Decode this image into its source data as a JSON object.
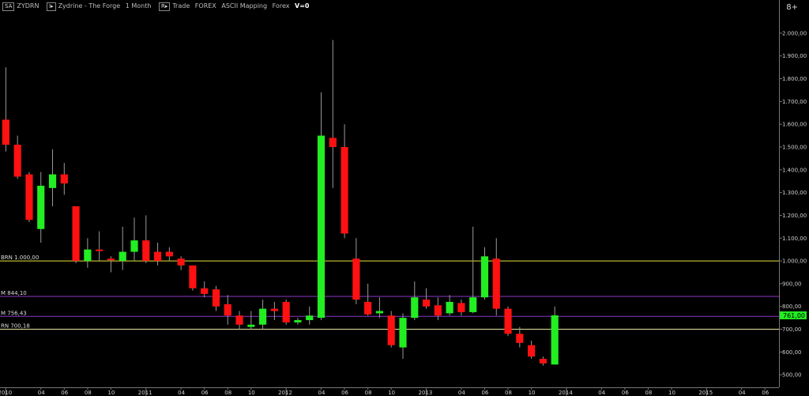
{
  "toolbar": {
    "symbol_box": "SA",
    "symbol": "ZYDRN",
    "interval_box": "I▸",
    "description": "Zydrine - The Forge",
    "period": "1 Month",
    "r_box": "R▸",
    "trade_label": "Trade",
    "market_label": "FOREX",
    "mapping_label": "ASCII Mapping",
    "forex_label": "Forex",
    "volume_label": "V=0",
    "corner_glyph": "8+"
  },
  "chart_data": {
    "type": "candlestick",
    "ylim": [
      445,
      2090
    ],
    "y_ticks": [
      500,
      600,
      700,
      800,
      900,
      1000,
      1100,
      1200,
      1300,
      1400,
      1500,
      1600,
      1700,
      1800,
      1900,
      2000
    ],
    "y_tick_labels": [
      "500,00",
      "600,00",
      "700,00",
      "800,00",
      "900,00",
      "1.000,00",
      "1.100,00",
      "1.200,00",
      "1.300,00",
      "1.400,00",
      "1.500,00",
      "1.600,00",
      "1.700,00",
      "1.800,00",
      "1.900,00",
      "2.000,00"
    ],
    "x_ticks": [
      {
        "month": 0,
        "label": "2010"
      },
      {
        "month": 3,
        "label": "04"
      },
      {
        "month": 5,
        "label": "06"
      },
      {
        "month": 7,
        "label": "08"
      },
      {
        "month": 9,
        "label": "10"
      },
      {
        "month": 12,
        "label": "2011"
      },
      {
        "month": 15,
        "label": "04"
      },
      {
        "month": 17,
        "label": "06"
      },
      {
        "month": 19,
        "label": "08"
      },
      {
        "month": 21,
        "label": "10"
      },
      {
        "month": 24,
        "label": "2012"
      },
      {
        "month": 27,
        "label": "04"
      },
      {
        "month": 29,
        "label": "06"
      },
      {
        "month": 31,
        "label": "08"
      },
      {
        "month": 33,
        "label": "10"
      },
      {
        "month": 36,
        "label": "2013"
      },
      {
        "month": 39,
        "label": "04"
      },
      {
        "month": 41,
        "label": "06"
      },
      {
        "month": 43,
        "label": "08"
      },
      {
        "month": 45,
        "label": "10"
      },
      {
        "month": 48,
        "label": "2014"
      },
      {
        "month": 51,
        "label": "04"
      },
      {
        "month": 53,
        "label": "06"
      },
      {
        "month": 55,
        "label": "08"
      },
      {
        "month": 57,
        "label": "10"
      },
      {
        "month": 60,
        "label": "2015"
      },
      {
        "month": 63,
        "label": "04"
      },
      {
        "month": 65,
        "label": "06"
      }
    ],
    "x_range_months": [
      -0.5,
      66.2
    ],
    "candles": [
      {
        "m": 0,
        "o": 1620,
        "h": 1850,
        "l": 1480,
        "c": 1510
      },
      {
        "m": 1,
        "o": 1510,
        "h": 1550,
        "l": 1360,
        "c": 1370
      },
      {
        "m": 2,
        "o": 1380,
        "h": 1390,
        "l": 1170,
        "c": 1180
      },
      {
        "m": 3,
        "o": 1140,
        "h": 1390,
        "l": 1080,
        "c": 1330
      },
      {
        "m": 4,
        "o": 1320,
        "h": 1490,
        "l": 1240,
        "c": 1380
      },
      {
        "m": 5,
        "o": 1380,
        "h": 1430,
        "l": 1290,
        "c": 1340
      },
      {
        "m": 6,
        "o": 1240,
        "h": 1240,
        "l": 990,
        "c": 1000
      },
      {
        "m": 7,
        "o": 1000,
        "h": 1100,
        "l": 970,
        "c": 1050
      },
      {
        "m": 8,
        "o": 1050,
        "h": 1130,
        "l": 1000,
        "c": 1045
      },
      {
        "m": 9,
        "o": 1010,
        "h": 1020,
        "l": 950,
        "c": 1005
      },
      {
        "m": 10,
        "o": 1000,
        "h": 1150,
        "l": 960,
        "c": 1040
      },
      {
        "m": 11,
        "o": 1040,
        "h": 1190,
        "l": 1000,
        "c": 1090
      },
      {
        "m": 12,
        "o": 1090,
        "h": 1200,
        "l": 990,
        "c": 1000
      },
      {
        "m": 13,
        "o": 1040,
        "h": 1080,
        "l": 980,
        "c": 1000
      },
      {
        "m": 14,
        "o": 1040,
        "h": 1060,
        "l": 1000,
        "c": 1020
      },
      {
        "m": 15,
        "o": 1010,
        "h": 1020,
        "l": 960,
        "c": 980
      },
      {
        "m": 16,
        "o": 980,
        "h": 980,
        "l": 870,
        "c": 880
      },
      {
        "m": 17,
        "o": 880,
        "h": 910,
        "l": 840,
        "c": 855
      },
      {
        "m": 18,
        "o": 875,
        "h": 890,
        "l": 780,
        "c": 800
      },
      {
        "m": 19,
        "o": 810,
        "h": 850,
        "l": 720,
        "c": 760
      },
      {
        "m": 20,
        "o": 760,
        "h": 780,
        "l": 700,
        "c": 720
      },
      {
        "m": 21,
        "o": 710,
        "h": 780,
        "l": 700,
        "c": 720
      },
      {
        "m": 22,
        "o": 720,
        "h": 830,
        "l": 700,
        "c": 790
      },
      {
        "m": 23,
        "o": 790,
        "h": 820,
        "l": 740,
        "c": 780
      },
      {
        "m": 24,
        "o": 820,
        "h": 830,
        "l": 720,
        "c": 730
      },
      {
        "m": 25,
        "o": 730,
        "h": 750,
        "l": 720,
        "c": 740
      },
      {
        "m": 26,
        "o": 740,
        "h": 800,
        "l": 720,
        "c": 760
      },
      {
        "m": 27,
        "o": 750,
        "h": 1740,
        "l": 740,
        "c": 1550
      },
      {
        "m": 28,
        "o": 1540,
        "h": 1970,
        "l": 1320,
        "c": 1500
      },
      {
        "m": 29,
        "o": 1500,
        "h": 1600,
        "l": 1100,
        "c": 1120
      },
      {
        "m": 30,
        "o": 1010,
        "h": 1100,
        "l": 810,
        "c": 830
      },
      {
        "m": 31,
        "o": 820,
        "h": 900,
        "l": 760,
        "c": 765
      },
      {
        "m": 32,
        "o": 770,
        "h": 840,
        "l": 750,
        "c": 780
      },
      {
        "m": 33,
        "o": 760,
        "h": 780,
        "l": 620,
        "c": 630
      },
      {
        "m": 34,
        "o": 620,
        "h": 770,
        "l": 570,
        "c": 750
      },
      {
        "m": 35,
        "o": 750,
        "h": 910,
        "l": 740,
        "c": 840
      },
      {
        "m": 36,
        "o": 830,
        "h": 880,
        "l": 790,
        "c": 800
      },
      {
        "m": 37,
        "o": 805,
        "h": 840,
        "l": 740,
        "c": 760
      },
      {
        "m": 38,
        "o": 770,
        "h": 850,
        "l": 760,
        "c": 820
      },
      {
        "m": 39,
        "o": 815,
        "h": 830,
        "l": 760,
        "c": 775
      },
      {
        "m": 40,
        "o": 775,
        "h": 1150,
        "l": 770,
        "c": 840
      },
      {
        "m": 41,
        "o": 840,
        "h": 1060,
        "l": 830,
        "c": 1020
      },
      {
        "m": 42,
        "o": 1010,
        "h": 1100,
        "l": 760,
        "c": 790
      },
      {
        "m": 43,
        "o": 790,
        "h": 800,
        "l": 670,
        "c": 680
      },
      {
        "m": 44,
        "o": 680,
        "h": 710,
        "l": 620,
        "c": 640
      },
      {
        "m": 45,
        "o": 630,
        "h": 650,
        "l": 570,
        "c": 580
      },
      {
        "m": 46,
        "o": 570,
        "h": 580,
        "l": 540,
        "c": 550
      },
      {
        "m": 47,
        "o": 545,
        "h": 800,
        "l": 545,
        "c": 761
      }
    ],
    "hlines": [
      {
        "value": 1000.0,
        "label": "BRN 1.000,00",
        "color": "#e8e43a"
      },
      {
        "value": 844.1,
        "label": "M 844,10",
        "color": "#8a38c8"
      },
      {
        "value": 756.43,
        "label": "M 756,43",
        "color": "#8a38c8"
      },
      {
        "value": 700.18,
        "label": "RN 700,18",
        "color": "#e8e8a0"
      }
    ],
    "last_value": 761.0,
    "last_label": "761,00",
    "colors": {
      "up": "#22ee22",
      "down": "#ff1111",
      "wick": "#9a9a9a",
      "tag_bg": "#22ee22"
    }
  }
}
